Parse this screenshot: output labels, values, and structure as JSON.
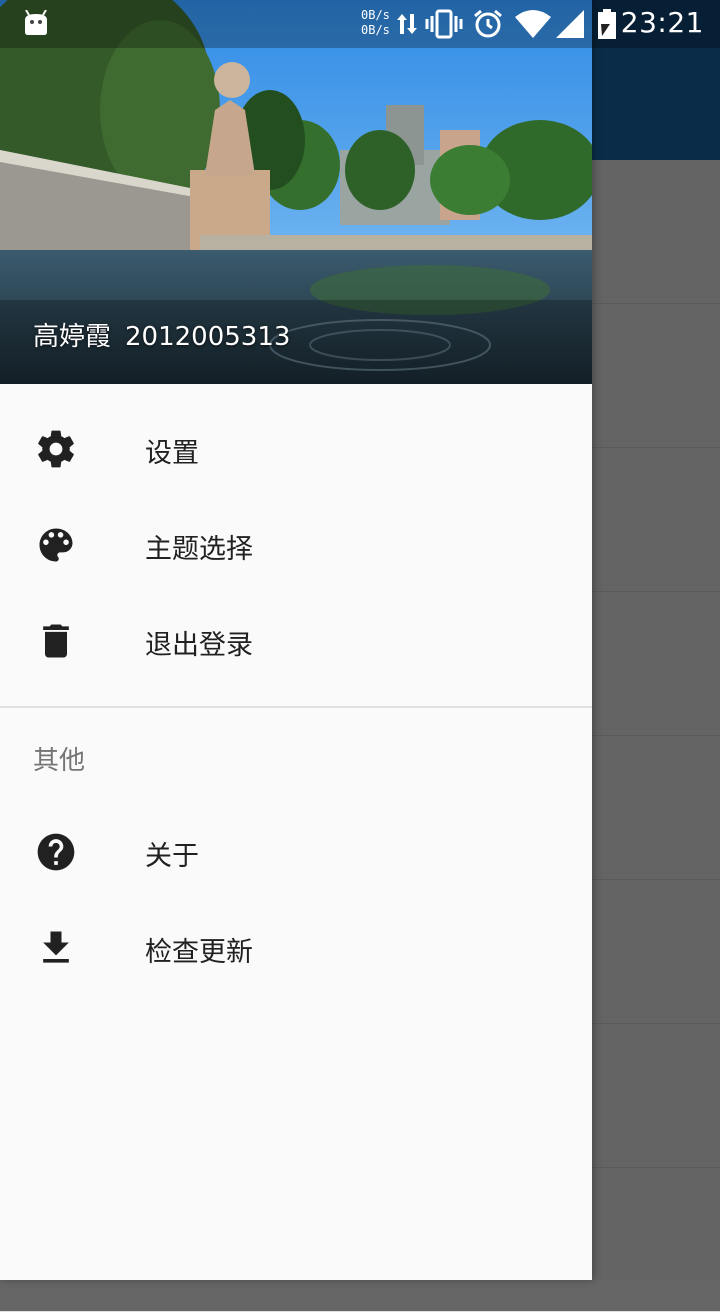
{
  "status_bar": {
    "net_up": "0B/s",
    "net_down": "0B/s",
    "time": "23:21",
    "icons": [
      "android-notification-icon",
      "data-transfer-icon",
      "vibrate-icon",
      "alarm-icon",
      "wifi-icon",
      "signal-icon",
      "battery-icon"
    ]
  },
  "drawer": {
    "header": {
      "user_name": "高婷霞",
      "user_id": "2012005313"
    },
    "items": [
      {
        "label": "设置",
        "icon": "gear-icon"
      },
      {
        "label": "主题选择",
        "icon": "palette-icon"
      },
      {
        "label": "退出登录",
        "icon": "trash-icon"
      }
    ],
    "section_title": "其他",
    "other_items": [
      {
        "label": "关于",
        "icon": "help-icon"
      },
      {
        "label": "检查更新",
        "icon": "download-icon"
      }
    ]
  },
  "colors": {
    "app_bar": "#1a6fb4",
    "drawer_bg": "#fafafa",
    "scrim": "rgba(0,0,0,0.6)",
    "icon": "#212121"
  }
}
